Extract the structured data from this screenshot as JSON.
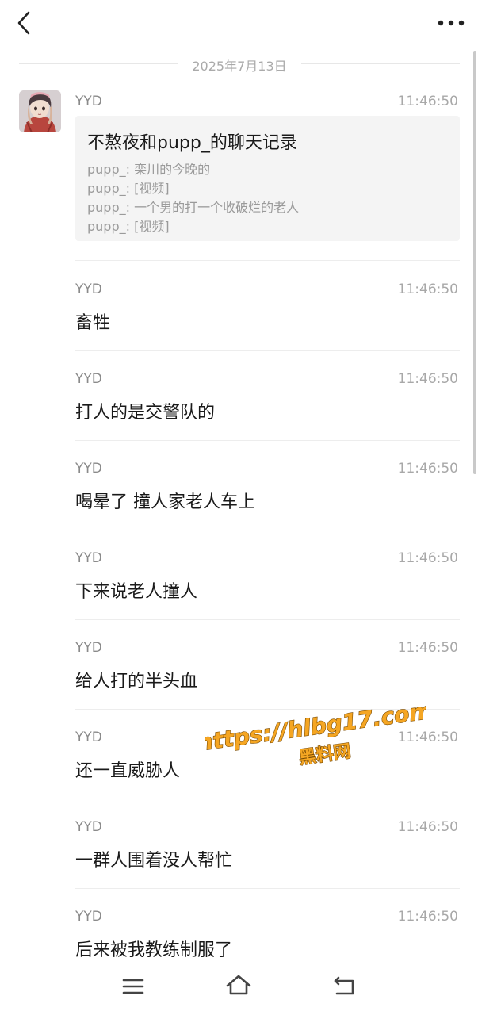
{
  "header": {
    "back_icon": "chevron-left-icon",
    "more_icon": "more-horizontal-icon"
  },
  "date_separator": "2025年7月13日",
  "chat_record": {
    "sender": "YYD",
    "time": "11:46:50",
    "title": "不熬夜和pupp_的聊天记录",
    "lines": [
      "pupp_: 栾川的今晚的",
      "pupp_: [视频]",
      "pupp_: 一个男的打一个收破烂的老人",
      "pupp_: [视频]"
    ]
  },
  "messages": [
    {
      "sender": "YYD",
      "time": "11:46:50",
      "text": "畜牲"
    },
    {
      "sender": "YYD",
      "time": "11:46:50",
      "text": "打人的是交警队的"
    },
    {
      "sender": "YYD",
      "time": "11:46:50",
      "text": "喝晕了 撞人家老人车上"
    },
    {
      "sender": "YYD",
      "time": "11:46:50",
      "text": "下来说老人撞人"
    },
    {
      "sender": "YYD",
      "time": "11:46:50",
      "text": "给人打的半头血"
    },
    {
      "sender": "YYD",
      "time": "11:46:50",
      "text": "还一直威胁人"
    },
    {
      "sender": "YYD",
      "time": "11:46:50",
      "text": "一群人围着没人帮忙"
    },
    {
      "sender": "YYD",
      "time": "11:46:50",
      "text": "后来被我教练制服了"
    }
  ],
  "watermark": {
    "url": "https://hlbg17.com",
    "label": "黑料网",
    "color": "#f5a623"
  },
  "nav": {
    "menu_icon": "menu-icon",
    "home_icon": "home-icon",
    "back_icon": "back-return-icon"
  },
  "colors": {
    "background": "#ffffff",
    "card_background": "#f4f4f4",
    "secondary_text": "#a8a8a8"
  }
}
